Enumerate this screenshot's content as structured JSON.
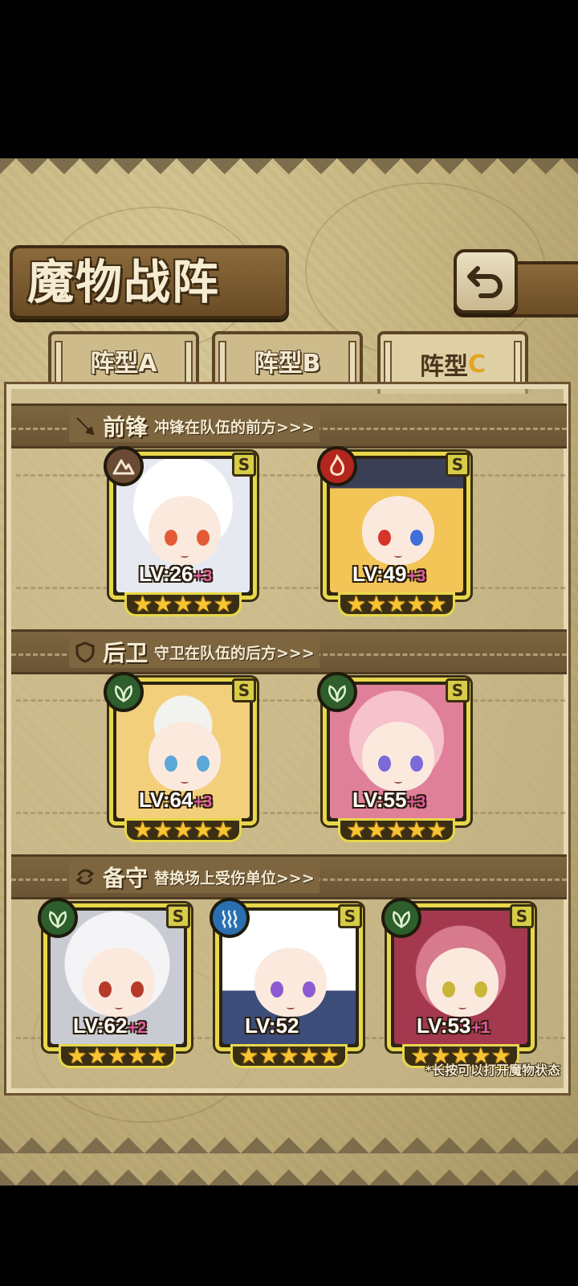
{
  "title": "魔物战阵",
  "back_button": {
    "icon": "return-arrow-icon"
  },
  "tabs": [
    {
      "label": "阵型A",
      "active": false
    },
    {
      "label": "阵型B",
      "active": false
    },
    {
      "label": "阵型",
      "letter": "C",
      "active": true
    }
  ],
  "sections": {
    "front": {
      "title": "前锋",
      "desc": "冲锋在队伍的前方>>>",
      "icon": "sword-icon"
    },
    "rear": {
      "title": "后卫",
      "desc": "守卫在队伍的后方>>>",
      "icon": "shield-icon"
    },
    "reserve": {
      "title": "备守",
      "desc": "替换场上受伤单位>>>",
      "icon": "swap-icon"
    }
  },
  "units": {
    "front": [
      {
        "element": "earth",
        "rank": "S",
        "level": "LV:26",
        "bonus": "+3",
        "stars": 5
      },
      {
        "element": "fire",
        "rank": "S",
        "level": "LV:49",
        "bonus": "+3",
        "stars": 5
      }
    ],
    "rear": [
      {
        "element": "grass",
        "rank": "S",
        "level": "LV:64",
        "bonus": "+3",
        "stars": 5
      },
      {
        "element": "grass",
        "rank": "S",
        "level": "LV:55",
        "bonus": "+3",
        "stars": 5
      }
    ],
    "reserve": [
      {
        "element": "grass",
        "rank": "S",
        "level": "LV:62",
        "bonus": "+2",
        "stars": 5
      },
      {
        "element": "water",
        "rank": "S",
        "level": "LV:52",
        "bonus": "",
        "stars": 5
      },
      {
        "element": "grass",
        "rank": "S",
        "level": "LV:53",
        "bonus": "+1",
        "stars": 5
      }
    ]
  },
  "hint": "*长按可以打开魔物状态",
  "colors": {
    "frame_yellow": "#e8d74a",
    "parchment": "#c7b681",
    "wood_dark": "#6a4c25",
    "bonus_pink": "#e55aa8",
    "star_gold": "#f7c531",
    "active_tab_letter": "#e2a626"
  }
}
